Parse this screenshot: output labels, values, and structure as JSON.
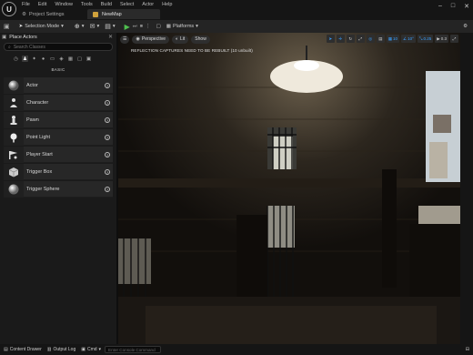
{
  "menu": [
    "File",
    "Edit",
    "Window",
    "Tools",
    "Build",
    "Select",
    "Actor",
    "Help"
  ],
  "project_tab": "Project Settings",
  "map_tab": "NewMap",
  "toolbar": {
    "mode": "Selection Mode",
    "platforms": "Platforms"
  },
  "place_actors": {
    "title": "Place Actors",
    "search_placeholder": "Search Classes",
    "section": "BASIC",
    "items": [
      {
        "label": "Actor",
        "icon": "sphere-icon"
      },
      {
        "label": "Character",
        "icon": "character-icon"
      },
      {
        "label": "Pawn",
        "icon": "pawn-icon"
      },
      {
        "label": "Point Light",
        "icon": "point-light-icon"
      },
      {
        "label": "Player Start",
        "icon": "player-start-icon"
      },
      {
        "label": "Trigger Box",
        "icon": "trigger-box-icon"
      },
      {
        "label": "Trigger Sphere",
        "icon": "trigger-sphere-icon"
      }
    ]
  },
  "viewport": {
    "perspective": "Perspective",
    "lit": "Lit",
    "show": "Show",
    "warning": "REFLECTION CAPTURES NEED TO BE REBUILT (10 unbuilt)",
    "grid_snap": "10",
    "rot_snap": "10°",
    "scale_snap": "0.25",
    "cam_speed": "0.3"
  },
  "statusbar": {
    "content_drawer": "Content Drawer",
    "output_log": "Output Log",
    "cmd": "Cmd",
    "cmd_placeholder": "Enter Console Command"
  }
}
